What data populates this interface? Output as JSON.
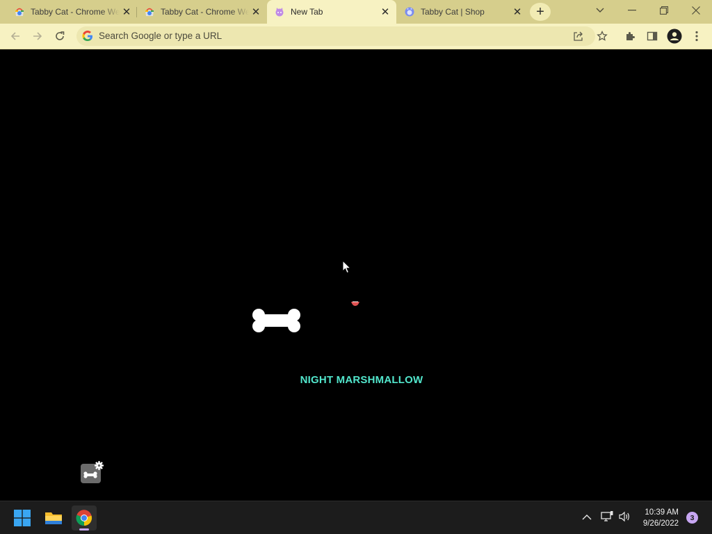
{
  "browser": {
    "tabs": [
      {
        "title": "Tabby Cat - Chrome Web Store",
        "favicon": "chrome-web-store-icon"
      },
      {
        "title": "Tabby Cat - Chrome Web Store",
        "favicon": "chrome-web-store-icon"
      },
      {
        "title": "New Tab",
        "favicon": "tabby-cat-icon"
      },
      {
        "title": "Tabby Cat | Shop",
        "favicon": "tabby-cat-shop-icon"
      }
    ],
    "new_tab": "+",
    "omnibox_placeholder": "Search Google or type a URL"
  },
  "page": {
    "cat_name": "NIGHT MARSHMALLOW",
    "accent_color": "#52e6cc"
  },
  "taskbar": {
    "time": "10:39 AM",
    "date": "9/26/2022",
    "notification_count": "3"
  }
}
